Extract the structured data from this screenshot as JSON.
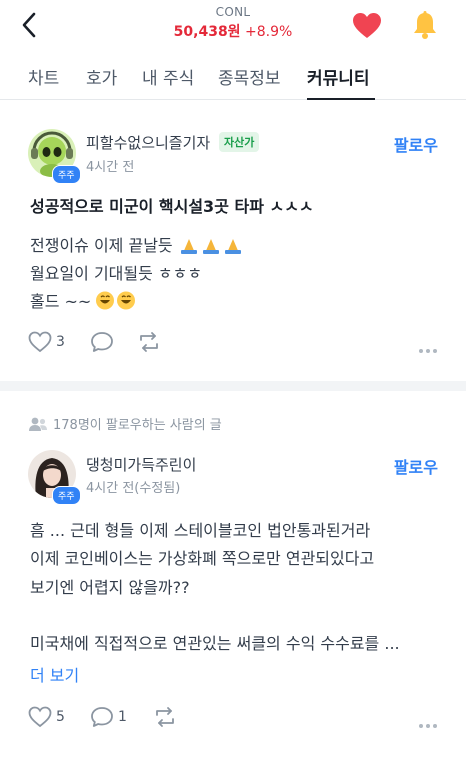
{
  "header": {
    "ticker": "CONL",
    "price": "50,438원",
    "change": "+8.9%"
  },
  "tabs": [
    {
      "label": "차트"
    },
    {
      "label": "호가"
    },
    {
      "label": "내 주식"
    },
    {
      "label": "종목정보"
    },
    {
      "label": "커뮤니티"
    }
  ],
  "post1": {
    "author": "피할수없으니즐기자",
    "tag": "자산가",
    "badge": "주주",
    "time": "4시간 전",
    "follow_label": "팔로우",
    "title": "성공적으로 미군이 핵시설3곳 타파 ㅅㅅㅅ",
    "lines": [
      "전쟁이슈   이제  끝날듯 ",
      "월요일이 기대될듯   ㅎㅎㅎ",
      "홀드 ~~"
    ],
    "likes": "3"
  },
  "notice": "178명이 팔로우하는 사람의 글",
  "post2": {
    "author": "댕청미가득주린이",
    "badge": "주주",
    "time": "4시간 전(수정됨)",
    "follow_label": "팔로우",
    "lines": [
      "흠 ... 근데 형들 이제 스테이블코인 법안통과된거라",
      "이제 코인베이스는  가상화폐 쪽으로만 연관되있다고",
      "보기엔 어렵지 않을까??",
      "미국채에  직접적으로 연관있는 써클의  수익 수수료를 ..."
    ],
    "more_label": "더 보기",
    "likes": "5",
    "comments": "1"
  },
  "colors": {
    "accent": "#3182f6",
    "price_up": "#e42939",
    "heart": "#f04452",
    "bell": "#ffc342"
  },
  "icons": [
    "back-arrow-icon",
    "heart-icon",
    "bell-icon",
    "like-icon",
    "comment-icon",
    "repost-icon",
    "more-dots-icon",
    "people-icon"
  ]
}
